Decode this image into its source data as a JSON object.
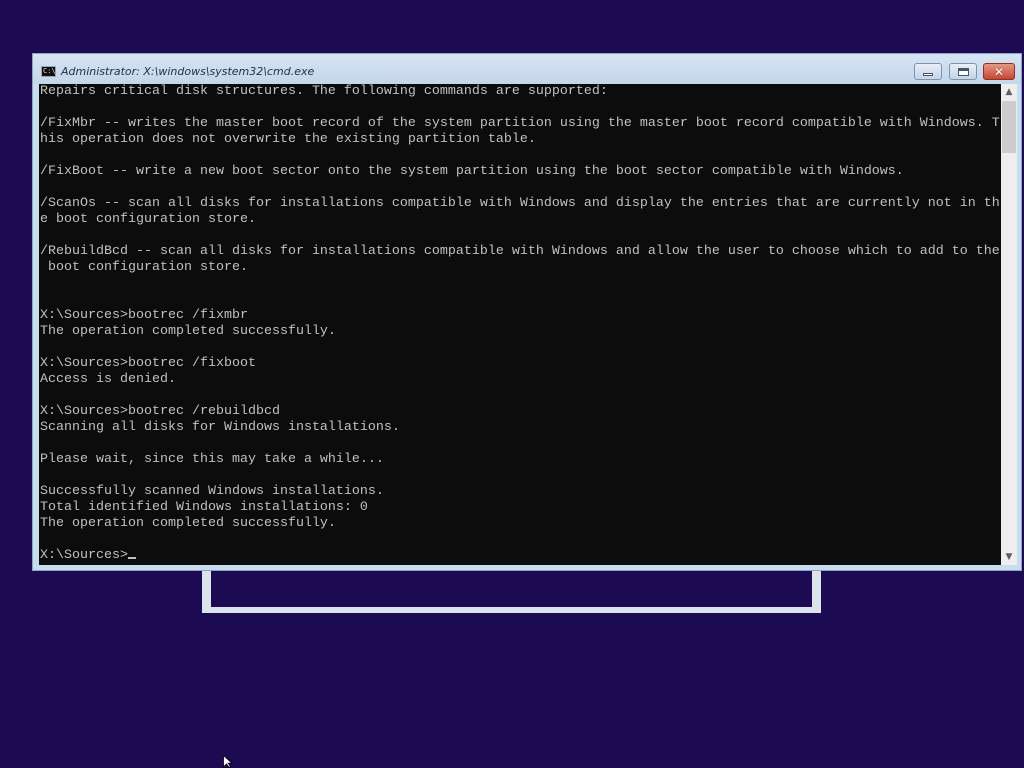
{
  "window": {
    "title": "Administrator: X:\\windows\\system32\\cmd.exe",
    "icon": "cmd-console-icon",
    "icon_text": "C:\\",
    "minimize_icon": "minimize-icon",
    "maximize_icon": "maximize-icon",
    "close_icon": "close-icon"
  },
  "console": {
    "lines": [
      "Repairs critical disk structures. The following commands are supported:",
      "",
      "/FixMbr -- writes the master boot record of the system partition using the master boot record compatible with Windows. T",
      "his operation does not overwrite the existing partition table.",
      "",
      "/FixBoot -- write a new boot sector onto the system partition using the boot sector compatible with Windows.",
      "",
      "/ScanOs -- scan all disks for installations compatible with Windows and display the entries that are currently not in th",
      "e boot configuration store.",
      "",
      "/RebuildBcd -- scan all disks for installations compatible with Windows and allow the user to choose which to add to the",
      " boot configuration store.",
      "",
      "",
      "X:\\Sources>bootrec /fixmbr",
      "The operation completed successfully.",
      "",
      "X:\\Sources>bootrec /fixboot",
      "Access is denied.",
      "",
      "X:\\Sources>bootrec /rebuildbcd",
      "Scanning all disks for Windows installations.",
      "",
      "Please wait, since this may take a while...",
      "",
      "Successfully scanned Windows installations.",
      "Total identified Windows installations: 0",
      "The operation completed successfully.",
      ""
    ],
    "prompt": "X:\\Sources>"
  },
  "scrollbar": {
    "up_icon": "scroll-up-arrow-icon",
    "down_icon": "scroll-down-arrow-icon"
  },
  "colors": {
    "desktop_background": "#1c0b52",
    "console_background": "#0c0c0c",
    "console_text": "#c0c0c0",
    "close_button": "#c74632"
  }
}
